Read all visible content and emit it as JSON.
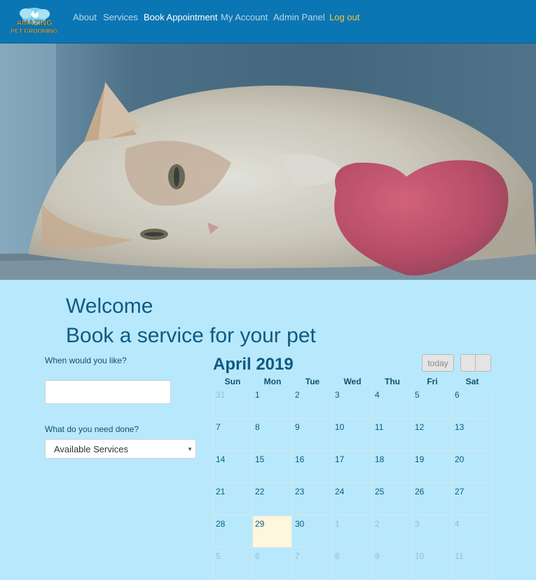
{
  "brand": {
    "logo_line1": "AMAZING",
    "logo_line2": "PET GROOMING"
  },
  "nav": {
    "about": "About",
    "services": "Services",
    "book": "Book Appointment",
    "account": "My Account",
    "admin": "Admin Panel",
    "logout": "Log out"
  },
  "hero": {
    "image": "cat-with-heart-photo"
  },
  "headings": {
    "welcome": "Welcome",
    "subtitle": "Book a service for your pet"
  },
  "form": {
    "when_label": "When would you like?",
    "when_value": "",
    "what_label": "What do you need done?",
    "service_selected": "Available Services"
  },
  "calendar": {
    "title": "April 2019",
    "today_label": "today",
    "days_of_week": [
      "Sun",
      "Mon",
      "Tue",
      "Wed",
      "Thu",
      "Fri",
      "Sat"
    ],
    "weeks": [
      [
        {
          "d": "31",
          "o": true
        },
        {
          "d": "1"
        },
        {
          "d": "2"
        },
        {
          "d": "3"
        },
        {
          "d": "4"
        },
        {
          "d": "5"
        },
        {
          "d": "6"
        }
      ],
      [
        {
          "d": "7"
        },
        {
          "d": "8"
        },
        {
          "d": "9"
        },
        {
          "d": "10"
        },
        {
          "d": "11"
        },
        {
          "d": "12"
        },
        {
          "d": "13"
        }
      ],
      [
        {
          "d": "14"
        },
        {
          "d": "15"
        },
        {
          "d": "16"
        },
        {
          "d": "17"
        },
        {
          "d": "18"
        },
        {
          "d": "19"
        },
        {
          "d": "20"
        }
      ],
      [
        {
          "d": "21"
        },
        {
          "d": "22"
        },
        {
          "d": "23"
        },
        {
          "d": "24"
        },
        {
          "d": "25"
        },
        {
          "d": "26"
        },
        {
          "d": "27"
        }
      ],
      [
        {
          "d": "28"
        },
        {
          "d": "29",
          "today": true
        },
        {
          "d": "30"
        },
        {
          "d": "1",
          "o": true
        },
        {
          "d": "2",
          "o": true
        },
        {
          "d": "3",
          "o": true
        },
        {
          "d": "4",
          "o": true
        }
      ],
      [
        {
          "d": "5",
          "o": true
        },
        {
          "d": "6",
          "o": true
        },
        {
          "d": "7",
          "o": true
        },
        {
          "d": "8",
          "o": true
        },
        {
          "d": "9",
          "o": true
        },
        {
          "d": "10",
          "o": true
        },
        {
          "d": "11",
          "o": true
        }
      ]
    ]
  },
  "colors": {
    "navbar": "#0a76b3",
    "page_bg": "#b8e8fb",
    "heading": "#0d5a83",
    "logout": "#f6c632",
    "today_bg": "#fef6dd"
  }
}
